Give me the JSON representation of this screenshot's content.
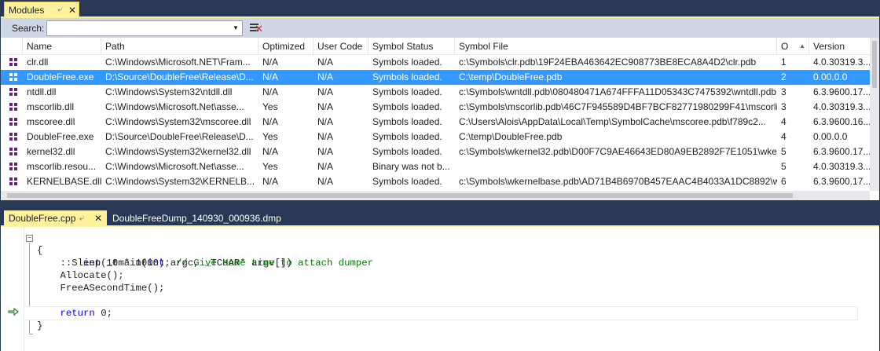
{
  "tool_window": {
    "title": "Modules",
    "pin_glyph": "⤶",
    "close_glyph": "✕"
  },
  "search": {
    "label": "Search:",
    "value": "",
    "placeholder": ""
  },
  "columns": [
    "Name",
    "Path",
    "Optimized",
    "User Code",
    "Symbol Status",
    "Symbol File",
    "O",
    "Version"
  ],
  "sort": {
    "column": "O",
    "direction": "ascending"
  },
  "modules": [
    {
      "name": "clr.dll",
      "path": "C:\\Windows\\Microsoft.NET\\Fram...",
      "optimized": "N/A",
      "user_code": "N/A",
      "symbol_status": "Symbols loaded.",
      "symbol_file": "c:\\Symbols\\clr.pdb\\19F24EBA463642EC908773BE8ECA8A4D2\\clr.pdb",
      "order": "1",
      "version": "4.0.30319.3...",
      "selected": false
    },
    {
      "name": "DoubleFree.exe",
      "path": "D:\\Source\\DoubleFree\\Release\\D...",
      "optimized": "N/A",
      "user_code": "N/A",
      "symbol_status": "Symbols loaded.",
      "symbol_file": "C:\\temp\\DoubleFree.pdb",
      "order": "2",
      "version": "0.00.0.0",
      "selected": true
    },
    {
      "name": "ntdll.dll",
      "path": "C:\\Windows\\System32\\ntdll.dll",
      "optimized": "N/A",
      "user_code": "N/A",
      "symbol_status": "Symbols loaded.",
      "symbol_file": "c:\\Symbols\\wntdll.pdb\\080480471A674FFFA11D05343C7475392\\wntdll.pdb",
      "order": "3",
      "version": "6.3.9600.17...",
      "selected": false
    },
    {
      "name": "mscorlib.dll",
      "path": "C:\\Windows\\Microsoft.Net\\asse...",
      "optimized": "Yes",
      "user_code": "N/A",
      "symbol_status": "Symbols loaded.",
      "symbol_file": "c:\\Symbols\\mscorlib.pdb\\46C7F945589D4BF7BCF82771980299F41\\mscorli...",
      "order": "3",
      "version": "4.0.30319.3...",
      "selected": false
    },
    {
      "name": "mscoree.dll",
      "path": "C:\\Windows\\System32\\mscoree.dll",
      "optimized": "N/A",
      "user_code": "N/A",
      "symbol_status": "Symbols loaded.",
      "symbol_file": "C:\\Users\\Alois\\AppData\\Local\\Temp\\SymbolCache\\mscoree.pdb\\f789c2...",
      "order": "4",
      "version": "6.3.9600.16...",
      "selected": false
    },
    {
      "name": "DoubleFree.exe",
      "path": "D:\\Source\\DoubleFree\\Release\\D...",
      "optimized": "Yes",
      "user_code": "N/A",
      "symbol_status": "Symbols loaded.",
      "symbol_file": "C:\\temp\\DoubleFree.pdb",
      "order": "4",
      "version": "0.00.0.0",
      "selected": false
    },
    {
      "name": "kernel32.dll",
      "path": "C:\\Windows\\System32\\kernel32.dll",
      "optimized": "N/A",
      "user_code": "N/A",
      "symbol_status": "Symbols loaded.",
      "symbol_file": "c:\\Symbols\\wkernel32.pdb\\D00F7C9AE46643ED80A9EB2892F7E1051\\wker...",
      "order": "5",
      "version": "6.3.9600.17...",
      "selected": false
    },
    {
      "name": "mscorlib.resou...",
      "path": "C:\\Windows\\Microsoft.Net\\asse...",
      "optimized": "Yes",
      "user_code": "N/A",
      "symbol_status": "Binary was not b...",
      "symbol_file": "",
      "order": "5",
      "version": "4.0.30319.3...",
      "selected": false
    },
    {
      "name": "KERNELBASE.dll",
      "path": "C:\\Windows\\System32\\KERNELB...",
      "optimized": "N/A",
      "user_code": "N/A",
      "symbol_status": "Symbols loaded.",
      "symbol_file": "c:\\Symbols\\wkernelbase.pdb\\AD71B4B6970B457EAAC4B4033A1DC8892\\w...",
      "order": "6",
      "version": "6.3.9600.17...",
      "selected": false
    }
  ],
  "editor": {
    "active_tab": "DoubleFree.cpp",
    "inactive_tab": "DoubleFreeDump_140930_000936.dmp",
    "code": {
      "sig_kw1": "int",
      "sig_mid": " _tmain(",
      "sig_kw2": "int",
      "sig_rest": " argc, _TCHAR* argv[])",
      "open_brace": "{",
      "sleep_code": "    ::Sleep(10 * 1000); ",
      "sleep_comment": "// Give some time to attach dumper",
      "allocate": "    Allocate();",
      "free_twice": "    FreeASecondTime();",
      "blank": "",
      "return_indent": "    ",
      "return_kw": "return",
      "return_rest": " 0;",
      "close_brace": "}"
    }
  },
  "colors": {
    "chrome": "#293955",
    "active_tab": "#fff29d",
    "selection": "#3399ff",
    "module_icon": "#68217a",
    "keyword": "#0000ff",
    "comment": "#008000"
  },
  "icons": {
    "module": "module-icon",
    "clear": "clear-search-icon",
    "instruction_pointer": "instruction-pointer-icon"
  }
}
